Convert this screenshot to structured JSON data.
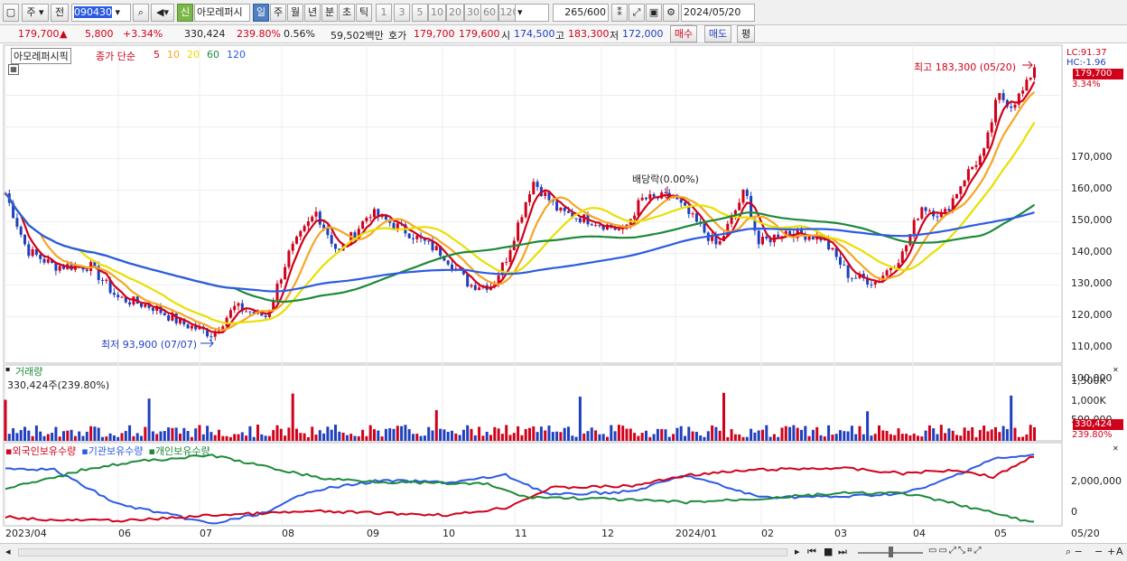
{
  "toolbar": {
    "market": "주",
    "prev": "전",
    "code": "090430",
    "stock_name": "아모레퍼시",
    "periods": [
      "일",
      "주",
      "월",
      "년",
      "분",
      "초",
      "틱"
    ],
    "intervals": [
      "1",
      "3",
      "5",
      "10",
      "20",
      "30",
      "60",
      "120"
    ],
    "count": "265",
    "count_max": "/600",
    "date": "2024/05/20",
    "badge": "신"
  },
  "quote": {
    "price": "179,700",
    "arrow": "▲",
    "change": "5,800",
    "change_pct": "+3.34%",
    "volume": "330,424",
    "vol_ratio": "239.80%",
    "turnover": "0.56%",
    "amount": "59,502백만",
    "ask_label": "호가",
    "ask": "179,700",
    "bid": "179,600",
    "open_label": "시",
    "open": "174,500",
    "high_label": "고",
    "high": "183,300",
    "low_label": "저",
    "low": "172,000",
    "buy": "매수",
    "sell": "매도",
    "eval": "평"
  },
  "price_panel": {
    "title": "아모레퍼시픽",
    "legend_main": "종가 단순",
    "ma": [
      {
        "label": "5",
        "color": "#d0021b"
      },
      {
        "label": "10",
        "color": "#f5a623"
      },
      {
        "label": "20",
        "color": "#e8e000"
      },
      {
        "label": "60",
        "color": "#1e8a3a"
      },
      {
        "label": "120",
        "color": "#2d5be3"
      }
    ],
    "lc": "LC:91.37",
    "hc": "HC:-1.96",
    "last_price_tag": "179,700",
    "last_pct": "3.34%",
    "high_note": "최고 183,300 (05/20)",
    "low_note": "최저 93,900 (07/07)",
    "div_note": "배당락(0.00%)",
    "y_ticks": [
      "170,000",
      "160,000",
      "150,000",
      "140,000",
      "130,000",
      "120,000",
      "110,000",
      "100,000"
    ]
  },
  "volume_panel": {
    "title": "거래량",
    "sub": "330,424주(239.80%)",
    "y_ticks": [
      "1,500K",
      "1,000K",
      "500,000"
    ],
    "tag": "330,424",
    "tag_pct": "239.80%"
  },
  "holding_panel": {
    "legend": [
      "외국인보유수량",
      "기관보유수량",
      "개인보유수량"
    ],
    "colors": [
      "#d0021b",
      "#2d5be3",
      "#1e8a3a"
    ],
    "y_ticks": [
      "2,000,000",
      "0"
    ]
  },
  "x_labels": [
    "2023/04",
    "06",
    "07",
    "08",
    "09",
    "10",
    "11",
    "12",
    "2024/01",
    "02",
    "03",
    "04",
    "05",
    "05/20"
  ],
  "colors": {
    "up": "#d0021b",
    "down": "#1f3fbf"
  }
}
